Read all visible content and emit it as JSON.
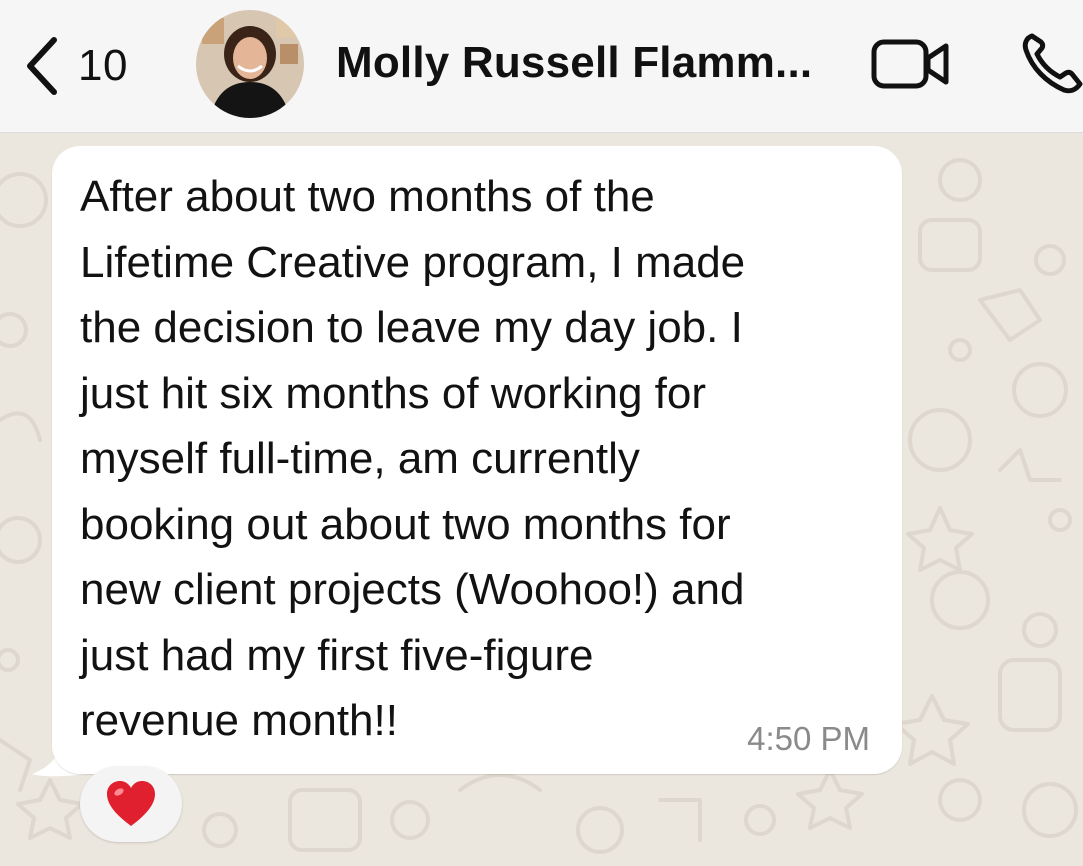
{
  "header": {
    "back_count": "10",
    "contact_name": "Molly Russell Flamm..."
  },
  "message": {
    "text": "After about two months of the\nLifetime Creative program, I made\nthe decision to leave my day job. I\njust hit six months of working for\nmyself full-time, am currently\nbooking out about two months for\nnew client projects (Woohoo!) and\njust had my first five-figure\nrevenue month!!",
    "time": "4:50 PM",
    "reaction": "heart"
  },
  "icons": {
    "back": "chevron-left-icon",
    "video": "video-camera-icon",
    "call": "phone-icon",
    "reaction": "red-heart-icon"
  },
  "colors": {
    "wallpaper": "#ebe6de",
    "header": "#f6f6f6",
    "bubble": "#ffffff",
    "heart": "#e0202e"
  }
}
